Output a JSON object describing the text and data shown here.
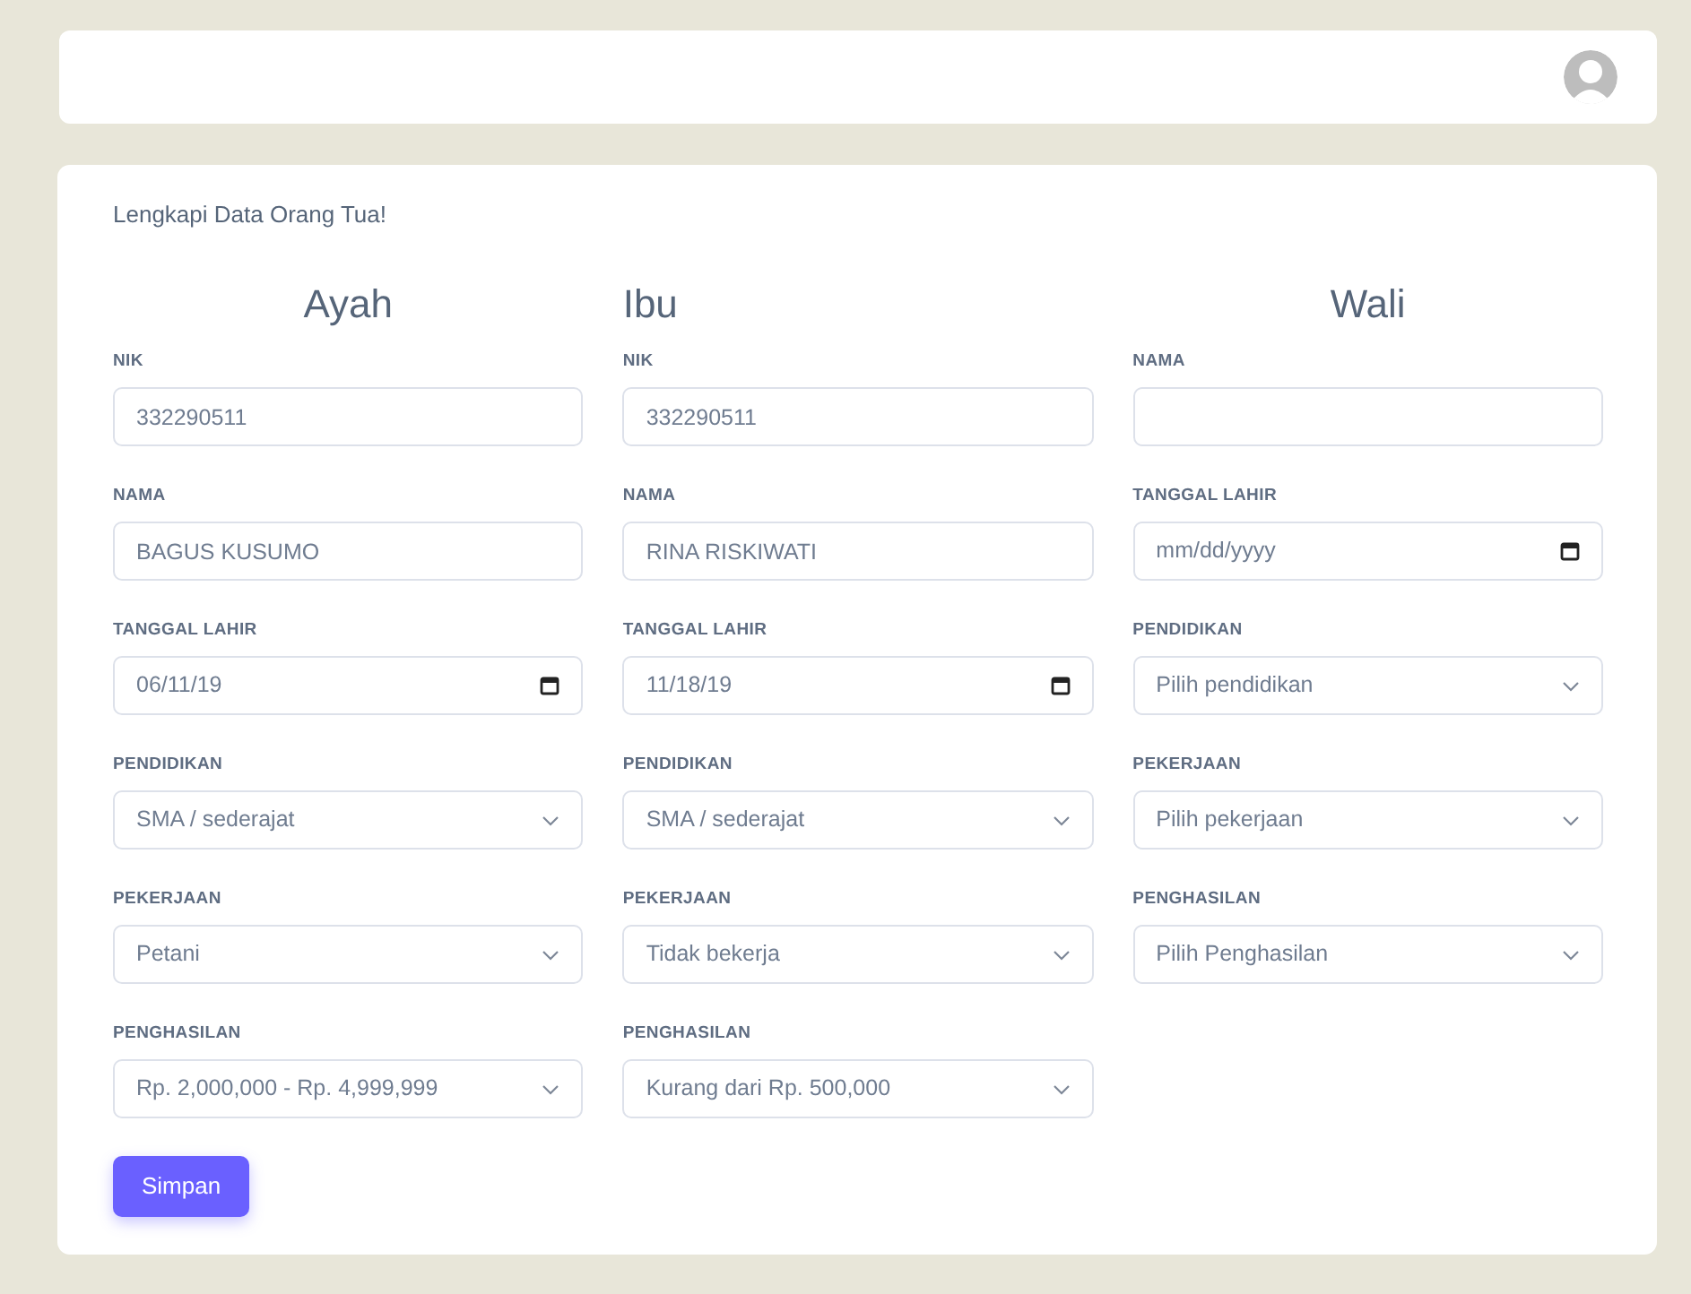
{
  "form": {
    "title": "Lengkapi Data Orang Tua!",
    "columns": [
      {
        "heading": "Ayah",
        "kind": "centered",
        "fields": [
          {
            "label": "NIK",
            "kind": "text",
            "value": "332290511"
          },
          {
            "label": "NAMA",
            "kind": "text",
            "value": "BAGUS KUSUMO"
          },
          {
            "label": "TANGGAL LAHIR",
            "kind": "date",
            "value": "06/11/19"
          },
          {
            "label": "PENDIDIKAN",
            "kind": "select",
            "value": "SMA / sederajat"
          },
          {
            "label": "PEKERJAAN",
            "kind": "select",
            "value": "Petani"
          },
          {
            "label": "PENGHASILAN",
            "kind": "select",
            "value": "Rp. 2,000,000 - Rp. 4,999,999"
          }
        ]
      },
      {
        "heading": "Ibu",
        "kind": "plain",
        "fields": [
          {
            "label": "NIK",
            "kind": "text",
            "value": "332290511"
          },
          {
            "label": "NAMA",
            "kind": "text",
            "value": "RINA RISKIWATI"
          },
          {
            "label": "TANGGAL LAHIR",
            "kind": "date",
            "value": "11/18/19"
          },
          {
            "label": "PENDIDIKAN",
            "kind": "select",
            "value": "SMA / sederajat"
          },
          {
            "label": "PEKERJAAN",
            "kind": "select",
            "value": "Tidak bekerja"
          },
          {
            "label": "PENGHASILAN",
            "kind": "select",
            "value": "Kurang dari Rp. 500,000"
          }
        ]
      },
      {
        "heading": "Wali",
        "kind": "centered",
        "fields": [
          {
            "label": "NAMA",
            "kind": "text"
          },
          {
            "label": "TANGGAL LAHIR",
            "kind": "date",
            "placeholder": "mm/dd/yyyy"
          },
          {
            "label": "PENDIDIKAN",
            "kind": "select",
            "value": "Pilih pendidikan"
          },
          {
            "label": "PEKERJAAN",
            "kind": "select",
            "value": "Pilih pekerjaan"
          },
          {
            "label": "PENGHASILAN",
            "kind": "select",
            "value": "Pilih Penghasilan"
          }
        ]
      }
    ],
    "submit": "Simpan"
  }
}
